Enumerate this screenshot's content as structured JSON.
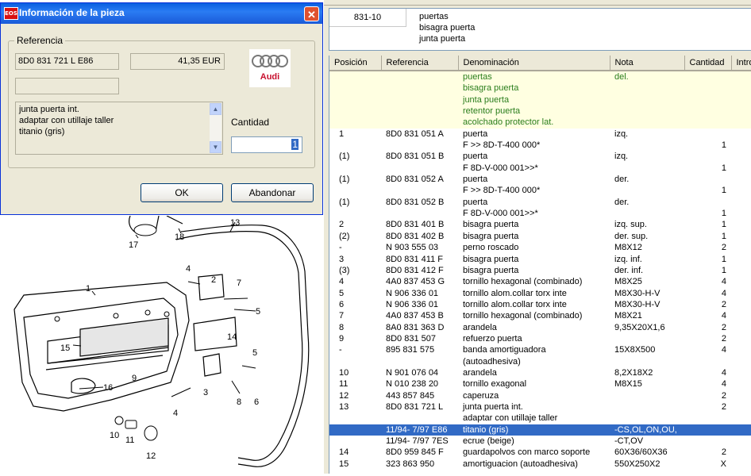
{
  "group": {
    "code": "831-10",
    "lines": [
      "puertas",
      "bisagra puerta",
      "junta puerta"
    ]
  },
  "columns": [
    "Posición",
    "Referencia",
    "Denominación",
    "Nota",
    "Cantidad",
    "Intro"
  ],
  "header_rows": [
    {
      "den": "puertas",
      "nota": "del."
    },
    {
      "den": "bisagra puerta",
      "nota": ""
    },
    {
      "den": "junta puerta",
      "nota": ""
    },
    {
      "den": "retentor puerta",
      "nota": ""
    },
    {
      "den": "acolchado protector lat.",
      "nota": ""
    }
  ],
  "rows": [
    {
      "pos": "1",
      "ref": "8D0 831 051 A",
      "den": "puerta",
      "nota": "izq.",
      "qty": ""
    },
    {
      "pos": "",
      "ref": "",
      "den": "F        >> 8D-T-400 000*",
      "nota": "",
      "qty": "1"
    },
    {
      "pos": "(1)",
      "ref": "8D0 831 051 B",
      "den": "puerta",
      "nota": "izq.",
      "qty": ""
    },
    {
      "pos": "",
      "ref": "",
      "den": "F 8D-V-000 001>>*",
      "nota": "",
      "qty": "1"
    },
    {
      "pos": "(1)",
      "ref": "8D0 831 052 A",
      "den": "puerta",
      "nota": "der.",
      "qty": ""
    },
    {
      "pos": "",
      "ref": "",
      "den": "F        >> 8D-T-400 000*",
      "nota": "",
      "qty": "1"
    },
    {
      "pos": "(1)",
      "ref": "8D0 831 052 B",
      "den": "puerta",
      "nota": "der.",
      "qty": ""
    },
    {
      "pos": "",
      "ref": "",
      "den": "F 8D-V-000 001>>*",
      "nota": "",
      "qty": "1"
    },
    {
      "pos": "2",
      "ref": "8D0 831 401 B",
      "den": "bisagra puerta",
      "nota": "izq. sup.",
      "qty": "1"
    },
    {
      "pos": "(2)",
      "ref": "8D0 831 402 B",
      "den": "bisagra puerta",
      "nota": "der. sup.",
      "qty": "1"
    },
    {
      "pos": "-",
      "ref": "N  903 555 03",
      "den": "perno roscado",
      "nota": "M8X12",
      "qty": "2"
    },
    {
      "pos": "3",
      "ref": "8D0 831 411 F",
      "den": "bisagra puerta",
      "nota": "izq. inf.",
      "qty": "1"
    },
    {
      "pos": "(3)",
      "ref": "8D0 831 412 F",
      "den": "bisagra puerta",
      "nota": "der. inf.",
      "qty": "1"
    },
    {
      "pos": "4",
      "ref": "4A0 837 453 G",
      "den": "tornillo hexagonal (combinado)",
      "nota": "M8X25",
      "qty": "4"
    },
    {
      "pos": "5",
      "ref": "N  906 336 01",
      "den": "tornillo alom.collar torx inte",
      "nota": "M8X30-H-V",
      "qty": "4"
    },
    {
      "pos": "6",
      "ref": "N  906 336 01",
      "den": "tornillo alom.collar torx inte",
      "nota": "M8X30-H-V",
      "qty": "2"
    },
    {
      "pos": "7",
      "ref": "4A0 837 453 B",
      "den": "tornillo hexagonal (combinado)",
      "nota": "M8X21",
      "qty": "4"
    },
    {
      "pos": "8",
      "ref": "8A0 831 363 D",
      "den": "arandela",
      "nota": "9,35X20X1,6",
      "qty": "2"
    },
    {
      "pos": "9",
      "ref": "8D0 831 507",
      "den": "refuerzo puerta",
      "nota": "",
      "qty": "2"
    },
    {
      "pos": "-",
      "ref": "895 831 575",
      "den": "banda amortiguadora",
      "nota": "15X8X500",
      "qty": "4"
    },
    {
      "pos": "",
      "ref": "",
      "den": "(autoadhesiva)",
      "nota": "",
      "qty": ""
    },
    {
      "pos": "10",
      "ref": "N  901 076 04",
      "den": "arandela",
      "nota": "8,2X18X2",
      "qty": "4"
    },
    {
      "pos": "11",
      "ref": "N  010 238 20",
      "den": "tornillo exagonal",
      "nota": "M8X15",
      "qty": "4"
    },
    {
      "pos": "12",
      "ref": "443 857 845",
      "den": "caperuza",
      "nota": "",
      "qty": "2"
    },
    {
      "pos": "13",
      "ref": "8D0 831 721 L",
      "den": "junta puerta int.",
      "nota": "",
      "qty": "2"
    },
    {
      "pos": "",
      "ref": "",
      "den": "adaptar con utillaje taller",
      "nota": "",
      "qty": ""
    },
    {
      "pos": "",
      "ref": "11/94- 7/97 E86",
      "den": "titanio (gris)",
      "nota": "-CS,OL,ON,OU,",
      "qty": "",
      "selected": true
    },
    {
      "pos": "",
      "ref": "11/94- 7/97 7ES",
      "den": "ecrue (beige)",
      "nota": "-CT,OV",
      "qty": ""
    },
    {
      "pos": "14",
      "ref": "8D0 959 845 F",
      "den": "guardapolvos con marco soporte",
      "nota": "60X36/60X36",
      "qty": "2"
    },
    {
      "pos": "15",
      "ref": "323 863 950",
      "den": "amortiguacion (autoadhesiva)",
      "nota": "550X250X2",
      "qty": "X"
    }
  ],
  "dialog": {
    "title": "Información de la pieza",
    "app_icon": "EOS",
    "legend": "Referencia",
    "reference": "8D0 831 721 L  E86",
    "price": "41,35 EUR",
    "brand": "Audi",
    "description": [
      "junta puerta int.",
      "adaptar con utillaje taller",
      "titanio (gris)"
    ],
    "quantity_label": "Cantidad",
    "quantity_value": "1",
    "ok": "OK",
    "cancel": "Abandonar"
  },
  "callouts": [
    "13",
    "17",
    "18",
    "1",
    "2",
    "4",
    "7",
    "5",
    "14",
    "15",
    "9",
    "16",
    "3",
    "5",
    "8",
    "6",
    "4",
    "10",
    "11",
    "12"
  ],
  "colors": {
    "selection": "#316ac5",
    "header_rows_bg": "#ffffe1",
    "header_rows_text": "#2a7d1c",
    "titlebar": "#0a5fe0"
  }
}
